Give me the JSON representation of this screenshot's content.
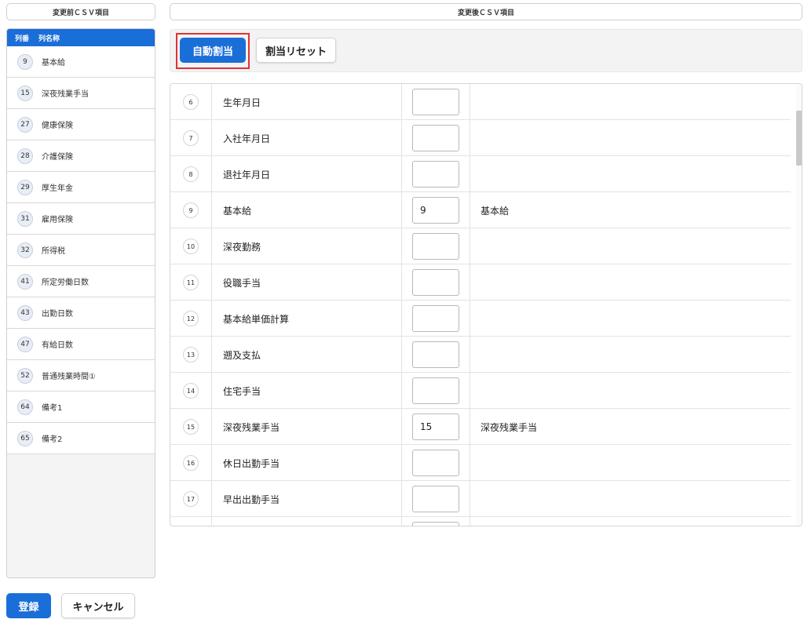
{
  "headers": {
    "before_label": "変更前ＣＳＶ項目",
    "after_label": "変更後ＣＳＶ項目"
  },
  "left_list": {
    "col_num_label": "列番",
    "col_name_label": "列名称",
    "items": [
      {
        "num": "9",
        "name": "基本給"
      },
      {
        "num": "15",
        "name": "深夜残業手当"
      },
      {
        "num": "27",
        "name": "健康保険"
      },
      {
        "num": "28",
        "name": "介護保険"
      },
      {
        "num": "29",
        "name": "厚生年金"
      },
      {
        "num": "31",
        "name": "雇用保険"
      },
      {
        "num": "32",
        "name": "所得税"
      },
      {
        "num": "41",
        "name": "所定労働日数"
      },
      {
        "num": "43",
        "name": "出勤日数"
      },
      {
        "num": "47",
        "name": "有給日数"
      },
      {
        "num": "52",
        "name": "普通残業時間①"
      },
      {
        "num": "64",
        "name": "備考1"
      },
      {
        "num": "65",
        "name": "備考2"
      }
    ]
  },
  "toolbar": {
    "auto_assign_label": "自動割当",
    "reset_label": "割当リセット"
  },
  "mapping": {
    "rows": [
      {
        "num": "6",
        "name": "生年月日",
        "value": "",
        "source": ""
      },
      {
        "num": "7",
        "name": "入社年月日",
        "value": "",
        "source": ""
      },
      {
        "num": "8",
        "name": "退社年月日",
        "value": "",
        "source": ""
      },
      {
        "num": "9",
        "name": "基本給",
        "value": "9",
        "source": "基本給"
      },
      {
        "num": "10",
        "name": "深夜勤務",
        "value": "",
        "source": ""
      },
      {
        "num": "11",
        "name": "役職手当",
        "value": "",
        "source": ""
      },
      {
        "num": "12",
        "name": "基本給単価計算",
        "value": "",
        "source": ""
      },
      {
        "num": "13",
        "name": "遡及支払",
        "value": "",
        "source": ""
      },
      {
        "num": "14",
        "name": "住宅手当",
        "value": "",
        "source": ""
      },
      {
        "num": "15",
        "name": "深夜残業手当",
        "value": "15",
        "source": "深夜残業手当"
      },
      {
        "num": "16",
        "name": "休日出勤手当",
        "value": "",
        "source": ""
      },
      {
        "num": "17",
        "name": "早出出勤手当",
        "value": "",
        "source": ""
      },
      {
        "num": "",
        "name": "",
        "value": "",
        "source": ""
      }
    ]
  },
  "footer": {
    "submit_label": "登録",
    "cancel_label": "キャンセル"
  },
  "colors": {
    "primary": "#1a6ed8",
    "highlight": "#e53030"
  }
}
